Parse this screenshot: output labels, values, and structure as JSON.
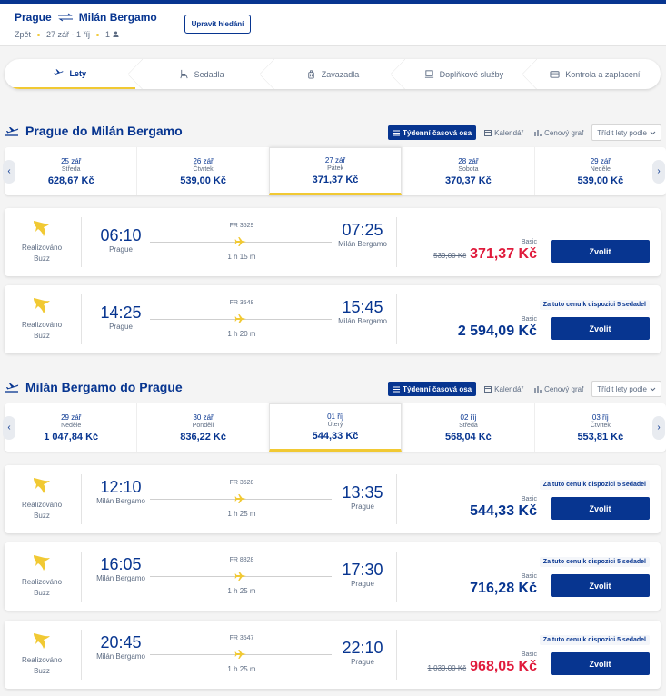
{
  "header": {
    "origin": "Prague",
    "destination": "Milán Bergamo",
    "trip_type": "Zpět",
    "dates": "27 zář - 1 říj",
    "passengers": "1",
    "edit_label": "Upravit hledání"
  },
  "steps": [
    {
      "label": "Lety",
      "icon": "plane-icon",
      "active": true
    },
    {
      "label": "Sedadla",
      "icon": "seat-icon"
    },
    {
      "label": "Zavazadla",
      "icon": "luggage-icon"
    },
    {
      "label": "Doplňkové služby",
      "icon": "laptop-icon"
    },
    {
      "label": "Kontrola a zaplacení",
      "icon": "card-icon"
    }
  ],
  "controls": {
    "weekly": "Týdenní časová osa",
    "calendar": "Kalendář",
    "price_graph": "Cenový graf",
    "sort": "Třídit lety podle"
  },
  "outbound": {
    "title": "Prague do Milán Bergamo",
    "dates": [
      {
        "date": "25 zář",
        "weekday": "Středa",
        "price": "628,67 Kč"
      },
      {
        "date": "26 zář",
        "weekday": "Čtvrtek",
        "price": "539,00 Kč"
      },
      {
        "date": "27 zář",
        "weekday": "Pátek",
        "price": "371,37 Kč",
        "selected": true
      },
      {
        "date": "28 zář",
        "weekday": "Sobota",
        "price": "370,37 Kč"
      },
      {
        "date": "29 zář",
        "weekday": "Neděle",
        "price": "539,00 Kč"
      }
    ],
    "flights": [
      {
        "operator": "Realizováno Buzz",
        "dep_time": "06:10",
        "dep_city": "Prague",
        "flight_no": "FR 3529",
        "duration": "1 h 15 m",
        "arr_time": "07:25",
        "arr_city": "Milán Bergamo",
        "badge": "",
        "fare": "Basic",
        "old_price": "539,00 Kč",
        "price": "371,37 Kč",
        "sale": true,
        "cta": "Zvolit"
      },
      {
        "operator": "Realizováno Buzz",
        "dep_time": "14:25",
        "dep_city": "Prague",
        "flight_no": "FR 3548",
        "duration": "1 h 20 m",
        "arr_time": "15:45",
        "arr_city": "Milán Bergamo",
        "badge": "Za tuto cenu k dispozici 5 sedadel",
        "fare": "Basic",
        "old_price": "",
        "price": "2 594,09 Kč",
        "sale": false,
        "cta": "Zvolit"
      }
    ]
  },
  "inbound": {
    "title": "Milán Bergamo do Prague",
    "dates": [
      {
        "date": "29 zář",
        "weekday": "Neděle",
        "price": "1 047,84 Kč"
      },
      {
        "date": "30 zář",
        "weekday": "Pondělí",
        "price": "836,22 Kč"
      },
      {
        "date": "01 říj",
        "weekday": "Úterý",
        "price": "544,33 Kč",
        "selected": true
      },
      {
        "date": "02 říj",
        "weekday": "Středa",
        "price": "568,04 Kč"
      },
      {
        "date": "03 říj",
        "weekday": "Čtvrtek",
        "price": "553,81 Kč"
      }
    ],
    "flights": [
      {
        "operator": "Realizováno Buzz",
        "dep_time": "12:10",
        "dep_city": "Milán Bergamo",
        "flight_no": "FR 3528",
        "duration": "1 h 25 m",
        "arr_time": "13:35",
        "arr_city": "Prague",
        "badge": "Za tuto cenu k dispozici 5 sedadel",
        "fare": "Basic",
        "old_price": "",
        "price": "544,33 Kč",
        "sale": false,
        "cta": "Zvolit"
      },
      {
        "operator": "Realizováno Buzz",
        "dep_time": "16:05",
        "dep_city": "Milán Bergamo",
        "flight_no": "FR 8828",
        "duration": "1 h 25 m",
        "arr_time": "17:30",
        "arr_city": "Prague",
        "badge": "Za tuto cenu k dispozici 5 sedadel",
        "fare": "Basic",
        "old_price": "",
        "price": "716,28 Kč",
        "sale": false,
        "cta": "Zvolit"
      },
      {
        "operator": "Realizováno Buzz",
        "dep_time": "20:45",
        "dep_city": "Milán Bergamo",
        "flight_no": "FR 3547",
        "duration": "1 h 25 m",
        "arr_time": "22:10",
        "arr_city": "Prague",
        "badge": "Za tuto cenu k dispozici 5 sedadel",
        "fare": "Basic",
        "old_price": "1 039,00 Kč",
        "price": "968,05 Kč",
        "sale": true,
        "cta": "Zvolit"
      }
    ]
  },
  "colors": {
    "brand": "#073590",
    "accent": "#f1c933",
    "sale": "#e01b3c"
  }
}
